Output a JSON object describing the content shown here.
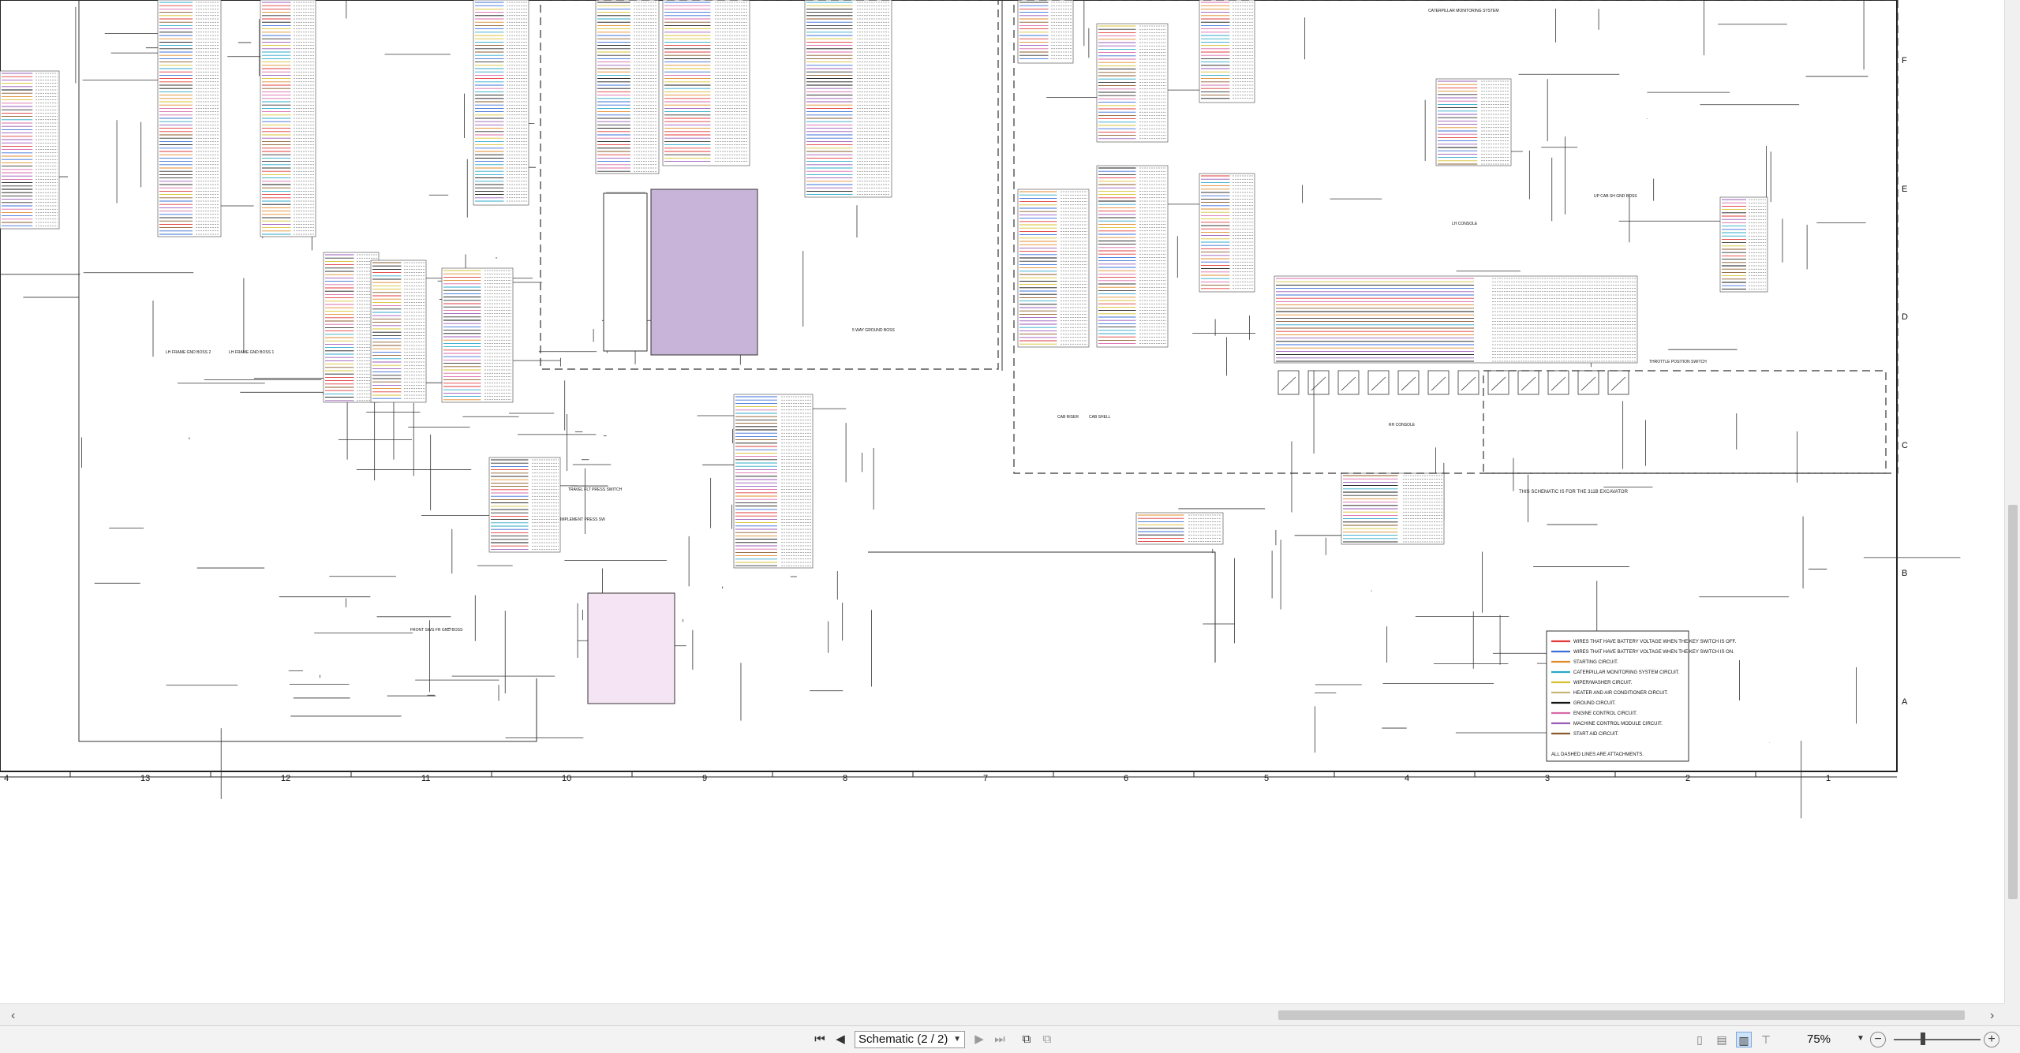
{
  "document": {
    "column_numbers": [
      "4",
      "13",
      "12",
      "11",
      "10",
      "9",
      "8",
      "7",
      "6",
      "5",
      "4",
      "3",
      "2",
      "1"
    ],
    "row_letters": [
      "F",
      "E",
      "D",
      "C",
      "B",
      "A"
    ]
  },
  "harness_labels": [
    "LH FRAME GND BOSS 2",
    "LH FRAME GND BOSS 1",
    "FRONT SWG FR GND BOSS",
    "RH CONSOLE",
    "LH CONSOLE",
    "CAB RISER",
    "CAB SHELL",
    "5 WAY GROUND BOSS",
    "TRAVEL FLT PRESS SWITCH",
    "IMPLEMENT PRESS SW",
    "UP CAB SH GND BOSS",
    "CATERPILLAR MONITORING SYSTEM",
    "THROTTLE POSITION SWITCH"
  ],
  "general_note": "THIS SCHEMATIC IS FOR THE 311B EXCAVATOR",
  "legend": {
    "items": [
      {
        "label": "WIRES THAT HAVE BATTERY VOLTAGE WHEN THE KEY SWITCH IS OFF.",
        "color": "#e03a3a"
      },
      {
        "label": "WIRES THAT HAVE BATTERY VOLTAGE WHEN THE KEY SWITCH IS ON.",
        "color": "#3a6fd8"
      },
      {
        "label": "STARTING CIRCUIT.",
        "color": "#e08a2a"
      },
      {
        "label": "CATERPILLAR MONITORING SYSTEM CIRCUIT.",
        "color": "#2aa8c8"
      },
      {
        "label": "WIPER/WASHER CIRCUIT.",
        "color": "#d8c030"
      },
      {
        "label": "HEATER AND AIR CONDITIONER CIRCUIT.",
        "color": "#c8b878"
      },
      {
        "label": "GROUND CIRCUIT.",
        "color": "#111111"
      },
      {
        "label": "ENGINE CONTROL CIRCUIT.",
        "color": "#d86aa8"
      },
      {
        "label": "MACHINE CONTROL MODULE CIRCUIT.",
        "color": "#9a5ab8"
      },
      {
        "label": "START AID CIRCUIT.",
        "color": "#8a5a2a"
      }
    ],
    "footer": "ALL DASHED LINES ARE ATTACHMENTS."
  },
  "toolbar": {
    "page_label": "Schematic (2 / 2)",
    "zoom": "75%",
    "zoom_out": "−",
    "zoom_in": "+"
  },
  "icons": {
    "first_page": "first-page-icon",
    "prev_page": "prev-page-icon",
    "next_page": "next-page-icon",
    "last_page": "last-page-icon"
  }
}
